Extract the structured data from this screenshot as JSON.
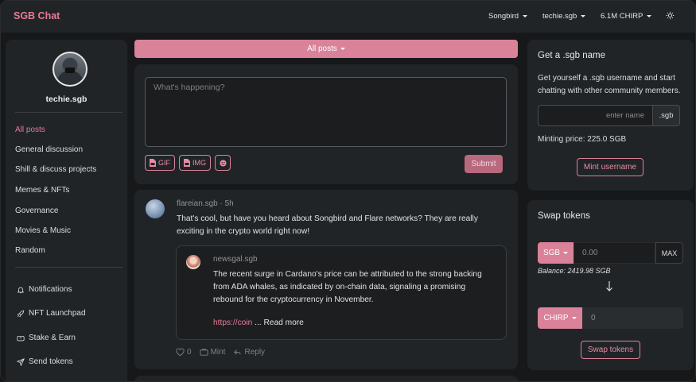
{
  "navbar": {
    "brand": "SGB Chat",
    "network": "Songbird",
    "account": "techie.sgb",
    "balance": "6.1M CHIRP",
    "theme_icon": "sun-icon"
  },
  "sidebar": {
    "profile_name": "techie.sgb",
    "categories": [
      {
        "label": "All posts",
        "active": true
      },
      {
        "label": "General discussion"
      },
      {
        "label": "Shill & discuss projects"
      },
      {
        "label": "Memes & NFTs"
      },
      {
        "label": "Governance"
      },
      {
        "label": "Movies & Music"
      },
      {
        "label": "Random"
      }
    ],
    "links": [
      {
        "label": "Notifications",
        "icon": "bell-icon"
      },
      {
        "label": "NFT Launchpad",
        "icon": "rocket-icon"
      },
      {
        "label": "Stake & Earn",
        "icon": "piggy-bank-icon"
      },
      {
        "label": "Send tokens",
        "icon": "send-icon"
      }
    ]
  },
  "feed": {
    "filter_label": "All posts",
    "composer": {
      "placeholder": "What's happening?",
      "gif_label": "GIF",
      "img_label": "IMG",
      "submit_label": "Submit"
    },
    "post": {
      "author": "flareian.sgb",
      "separator": "·",
      "time": "5h",
      "text": "That's cool, but have you heard about Songbird and Flare networks? They are really exciting in the crypto world right now!",
      "quote": {
        "author": "newsgal.sgb",
        "text": "The recent surge in Cardano's price can be attributed to the strong backing from ADA whales, as indicated by on-chain data, signaling a promising rebound for the cryptocurrency in November.",
        "link": "https://coin",
        "ellipsis": " ... ",
        "read_more": "Read more"
      },
      "likes": "0",
      "mint_label": "Mint",
      "reply_label": "Reply"
    }
  },
  "name_card": {
    "title": "Get a .sgb name",
    "description": "Get yourself a .sgb username and start chatting with other community members.",
    "input_placeholder": "enter name",
    "suffix": ".sgb",
    "price_text": "Minting price: 225.0 SGB",
    "mint_button": "Mint username"
  },
  "swap_card": {
    "title": "Swap tokens",
    "from_token": "SGB",
    "from_placeholder": "0.00",
    "max_label": "MAX",
    "balance_text": "Balance: 2419.98 SGB",
    "to_token": "CHIRP",
    "to_placeholder": "0",
    "swap_button": "Swap tokens"
  },
  "colors": {
    "accent": "#e97a97",
    "accent_fill": "#d98299",
    "panel": "#212427",
    "background": "#16181a"
  }
}
